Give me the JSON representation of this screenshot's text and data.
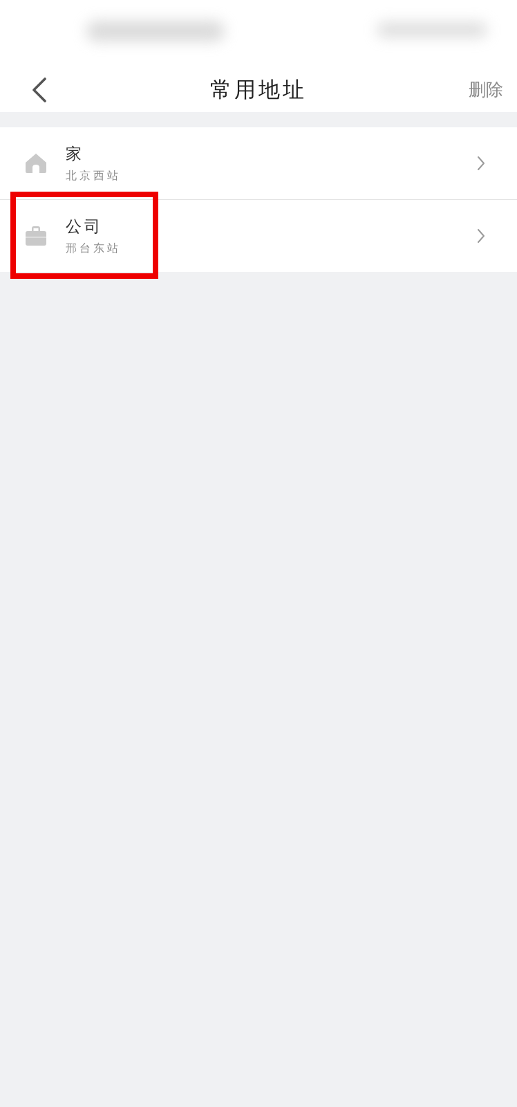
{
  "nav": {
    "title": "常用地址",
    "action": "删除"
  },
  "addresses": [
    {
      "kind": "home",
      "name": "家",
      "detail": "北京西站",
      "highlighted": false
    },
    {
      "kind": "work",
      "name": "公司",
      "detail": "邢台东站",
      "highlighted": true
    }
  ]
}
